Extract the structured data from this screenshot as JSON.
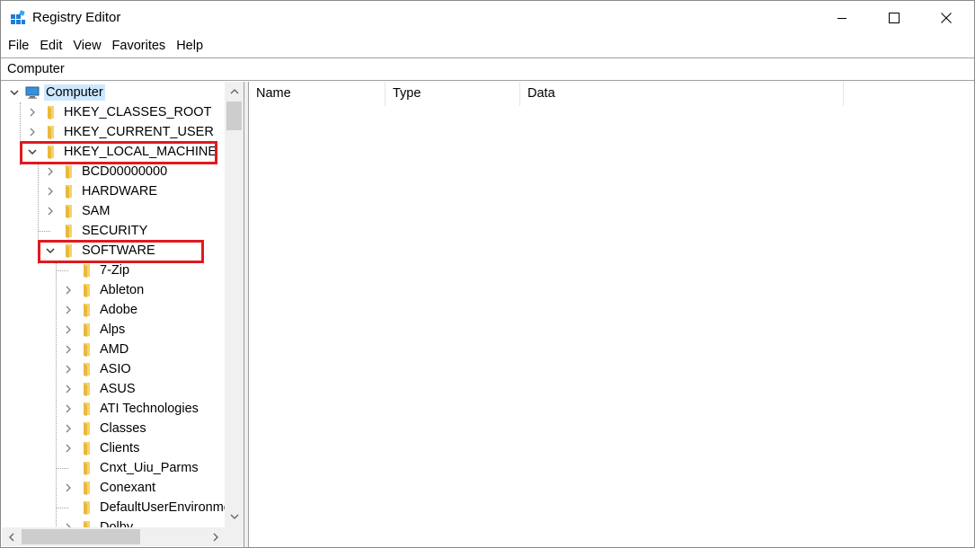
{
  "window": {
    "title": "Registry Editor"
  },
  "menu": [
    "File",
    "Edit",
    "View",
    "Favorites",
    "Help"
  ],
  "address": "Computer",
  "tree": [
    {
      "label": "Computer",
      "depth": 0,
      "expander": "expanded",
      "icon": "computer-icon",
      "selected": true
    },
    {
      "label": "HKEY_CLASSES_ROOT",
      "depth": 1,
      "expander": "collapsed",
      "icon": "folder-icon"
    },
    {
      "label": "HKEY_CURRENT_USER",
      "depth": 1,
      "expander": "collapsed",
      "icon": "folder-icon"
    },
    {
      "label": "HKEY_LOCAL_MACHINE",
      "depth": 1,
      "expander": "expanded",
      "icon": "folder-icon",
      "highlighted": true
    },
    {
      "label": "BCD00000000",
      "depth": 2,
      "expander": "collapsed",
      "icon": "folder-icon"
    },
    {
      "label": "HARDWARE",
      "depth": 2,
      "expander": "collapsed",
      "icon": "folder-icon"
    },
    {
      "label": "SAM",
      "depth": 2,
      "expander": "collapsed",
      "icon": "folder-icon"
    },
    {
      "label": "SECURITY",
      "depth": 2,
      "expander": "none",
      "icon": "folder-icon"
    },
    {
      "label": "SOFTWARE",
      "depth": 2,
      "expander": "expanded",
      "icon": "folder-icon",
      "highlighted": true
    },
    {
      "label": "7-Zip",
      "depth": 3,
      "expander": "none",
      "icon": "folder-icon"
    },
    {
      "label": "Ableton",
      "depth": 3,
      "expander": "collapsed",
      "icon": "folder-icon"
    },
    {
      "label": "Adobe",
      "depth": 3,
      "expander": "collapsed",
      "icon": "folder-icon"
    },
    {
      "label": "Alps",
      "depth": 3,
      "expander": "collapsed",
      "icon": "folder-icon"
    },
    {
      "label": "AMD",
      "depth": 3,
      "expander": "collapsed",
      "icon": "folder-icon"
    },
    {
      "label": "ASIO",
      "depth": 3,
      "expander": "collapsed",
      "icon": "folder-icon"
    },
    {
      "label": "ASUS",
      "depth": 3,
      "expander": "collapsed",
      "icon": "folder-icon"
    },
    {
      "label": "ATI Technologies",
      "depth": 3,
      "expander": "collapsed",
      "icon": "folder-icon"
    },
    {
      "label": "Classes",
      "depth": 3,
      "expander": "collapsed",
      "icon": "folder-icon"
    },
    {
      "label": "Clients",
      "depth": 3,
      "expander": "collapsed",
      "icon": "folder-icon"
    },
    {
      "label": "Cnxt_Uiu_Parms",
      "depth": 3,
      "expander": "none",
      "icon": "folder-icon"
    },
    {
      "label": "Conexant",
      "depth": 3,
      "expander": "collapsed",
      "icon": "folder-icon"
    },
    {
      "label": "DefaultUserEnvironment",
      "depth": 3,
      "expander": "none",
      "icon": "folder-icon"
    },
    {
      "label": "Dolby",
      "depth": 3,
      "expander": "collapsed",
      "icon": "folder-icon"
    }
  ],
  "list": {
    "columns": [
      "Name",
      "Type",
      "Data"
    ]
  },
  "colors": {
    "selection": "#cce8ff",
    "highlight_box": "#e0191f",
    "folder": "#f6d36d",
    "border": "#a0a0a0"
  }
}
